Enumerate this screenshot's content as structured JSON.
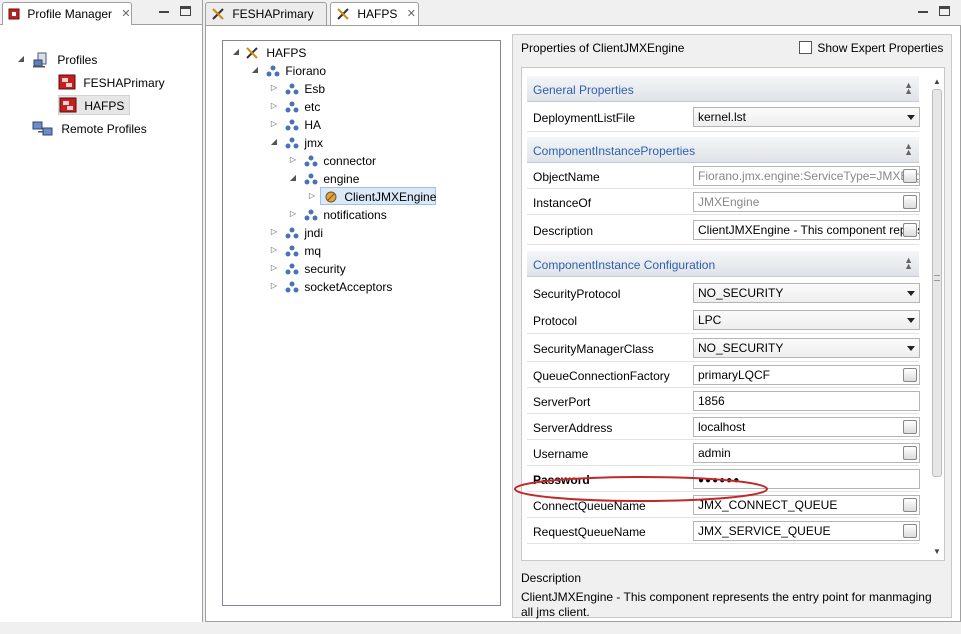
{
  "left_view": {
    "tab_label": "Profile Manager",
    "tree": [
      {
        "label": "Profiles"
      },
      {
        "label": "FESHAPrimary"
      },
      {
        "label": "HAFPS"
      },
      {
        "label": "Remote Profiles"
      }
    ]
  },
  "editor": {
    "tabs": [
      {
        "label": "FESHAPrimary"
      },
      {
        "label": "HAFPS"
      }
    ],
    "tree": [
      {
        "label": "HAFPS"
      },
      {
        "label": "Fiorano"
      },
      {
        "label": "Esb"
      },
      {
        "label": "etc"
      },
      {
        "label": "HA"
      },
      {
        "label": "jmx"
      },
      {
        "label": "connector"
      },
      {
        "label": "engine"
      },
      {
        "label": "ClientJMXEngine"
      },
      {
        "label": "notifications"
      },
      {
        "label": "jndi"
      },
      {
        "label": "mq"
      },
      {
        "label": "security"
      },
      {
        "label": "socketAcceptors"
      }
    ]
  },
  "properties": {
    "title": "Properties of ClientJMXEngine",
    "expert_label": "Show Expert Properties",
    "sections": [
      {
        "title": "General Properties",
        "rows": [
          {
            "name": "DeploymentListFile",
            "value": "kernel.lst"
          }
        ]
      },
      {
        "title": "ComponentInstanceProperties",
        "rows": [
          {
            "name": "ObjectName",
            "value": "Fiorano.jmx.engine:ServiceType=JMXEngine"
          },
          {
            "name": "InstanceOf",
            "value": "JMXEngine"
          },
          {
            "name": "Description",
            "value": "ClientJMXEngine - This component represents the entry point for manmaging all jms client."
          }
        ]
      },
      {
        "title": "ComponentInstance Configuration",
        "rows": [
          {
            "name": "SecurityProtocol",
            "value": "NO_SECURITY"
          },
          {
            "name": "Protocol",
            "value": "LPC"
          },
          {
            "name": "SecurityManagerClass",
            "value": "NO_SECURITY"
          },
          {
            "name": "QueueConnectionFactory",
            "value": "primaryLQCF"
          },
          {
            "name": "ServerPort",
            "value": "1856"
          },
          {
            "name": "ServerAddress",
            "value": "localhost"
          },
          {
            "name": "Username",
            "value": "admin"
          },
          {
            "name": "Password",
            "value": "●●●●●●"
          },
          {
            "name": "ConnectQueueName",
            "value": "JMX_CONNECT_QUEUE"
          },
          {
            "name": "RequestQueueName",
            "value": "JMX_SERVICE_QUEUE"
          }
        ]
      }
    ],
    "description": {
      "title": "Description",
      "text": "ClientJMXEngine - This component represents the entry point for manmaging all jms client."
    }
  },
  "colors": {
    "section_title": "#2d5fb0",
    "selection_bg": "#dbe8f8",
    "highlight_oval": "#c0282a"
  }
}
